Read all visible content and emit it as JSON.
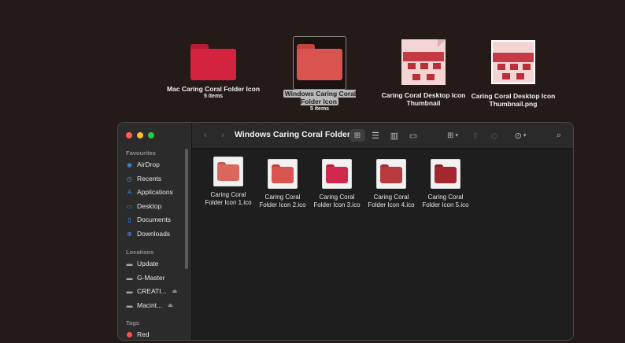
{
  "desktop": {
    "items": [
      {
        "name": "Mac Caring Coral Folder Icon",
        "count": "5 items",
        "color": "#d4233f"
      },
      {
        "name": "Windows Caring Coral Folder Icon",
        "count": "5 items",
        "color": "#d9534f"
      },
      {
        "name": "Caring Coral Desktop Icon Thumbnail"
      },
      {
        "name": "Caring Coral Desktop Icon Thumbnail.png"
      }
    ]
  },
  "window": {
    "title": "Windows Caring Coral Folder...",
    "sidebar": {
      "favourites_label": "Favourites",
      "favourites": [
        "AirDrop",
        "Recents",
        "Applications",
        "Desktop",
        "Documents",
        "Downloads"
      ],
      "locations_label": "Locations",
      "locations": [
        "Update",
        "G-Master",
        "CREATI...",
        "Macint..."
      ],
      "tags_label": "Tags",
      "tags": [
        "Red"
      ]
    },
    "files": [
      {
        "line1": "Caring Coral",
        "line2": "Folder Icon 1.ico",
        "color": "#d9675c"
      },
      {
        "line1": "Caring Coral",
        "line2": "Folder Icon 2.ico",
        "color": "#d9534f"
      },
      {
        "line1": "Caring Coral",
        "line2": "Folder Icon 3.ico",
        "color": "#cf2a4b"
      },
      {
        "line1": "Caring Coral",
        "line2": "Folder Icon 4.ico",
        "color": "#b83a3d"
      },
      {
        "line1": "Caring Coral",
        "line2": "Folder Icon 5.ico",
        "color": "#a3272e"
      }
    ]
  },
  "colors": {
    "desktop_bg": "#241a18",
    "accent": "#3d8af7",
    "tag_red": "#f0524c"
  }
}
